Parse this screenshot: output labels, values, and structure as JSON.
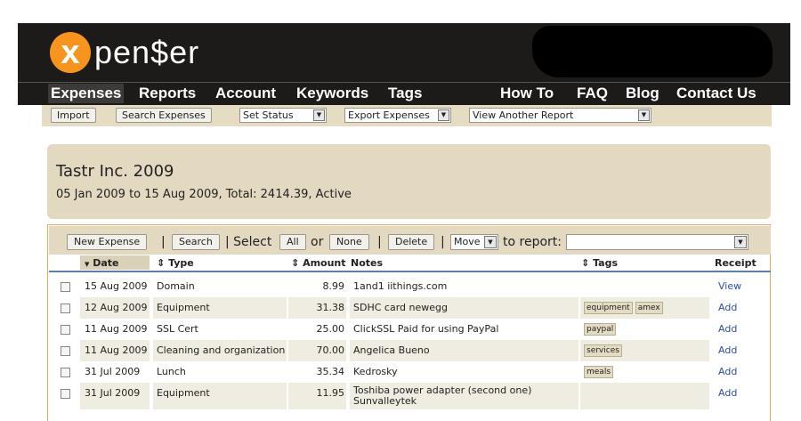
{
  "app": {
    "logo_letter": "x",
    "logo_text": "pen$er",
    "brand_color": "#f7941d"
  },
  "nav": {
    "left": [
      "Expenses",
      "Reports",
      "Account",
      "Keywords",
      "Tags"
    ],
    "right": [
      "How To",
      "FAQ",
      "Blog",
      "Contact Us"
    ],
    "active": "Expenses"
  },
  "toolbar": {
    "import_label": "Import",
    "search_label": "Search Expenses",
    "set_status": "Set Status",
    "export": "Export Expenses",
    "view_report": "View Another Report"
  },
  "report": {
    "title": "Tastr Inc. 2009",
    "summary": "05 Jan 2009 to 15 Aug 2009, Total: 2414.39, Active"
  },
  "actions": {
    "new_expense": "New Expense",
    "search": "Search",
    "select_text": "Select",
    "all": "All",
    "or_text": "or",
    "none": "None",
    "delete": "Delete",
    "move": "Move",
    "to_report": "to report:",
    "sep": "|"
  },
  "table": {
    "headers": {
      "date": "Date",
      "type": "Type",
      "amount": "Amount",
      "notes": "Notes",
      "tags": "Tags",
      "receipt": "Receipt"
    },
    "sort_glyph": "▼",
    "both_glyph": "⇕",
    "rows": [
      {
        "date": "15 Aug 2009",
        "type": "Domain",
        "amount": "8.99",
        "notes": "1and1 iithings.com",
        "notes2": "",
        "tags": [],
        "receipt": "View"
      },
      {
        "date": "12 Aug 2009",
        "type": "Equipment",
        "amount": "31.38",
        "notes": "SDHC card newegg",
        "notes2": "",
        "tags": [
          "equipment",
          "amex"
        ],
        "receipt": "Add"
      },
      {
        "date": "11 Aug 2009",
        "type": "SSL Cert",
        "amount": "25.00",
        "notes": "ClickSSL Paid for using PayPal",
        "notes2": "",
        "tags": [
          "paypal"
        ],
        "receipt": "Add"
      },
      {
        "date": "11 Aug 2009",
        "type": "Cleaning and organization",
        "amount": "70.00",
        "notes": "Angelica Bueno",
        "notes2": "",
        "tags": [
          "services"
        ],
        "receipt": "Add"
      },
      {
        "date": "31 Jul 2009",
        "type": "Lunch",
        "amount": "35.34",
        "notes": "Kedrosky",
        "notes2": "",
        "tags": [
          "meals"
        ],
        "receipt": "Add"
      },
      {
        "date": "31 Jul 2009",
        "type": "Equipment",
        "amount": "11.95",
        "notes": "Toshiba power adapter (second one)",
        "notes2": "Sunvalleytek",
        "tags": [],
        "receipt": "Add"
      }
    ]
  }
}
